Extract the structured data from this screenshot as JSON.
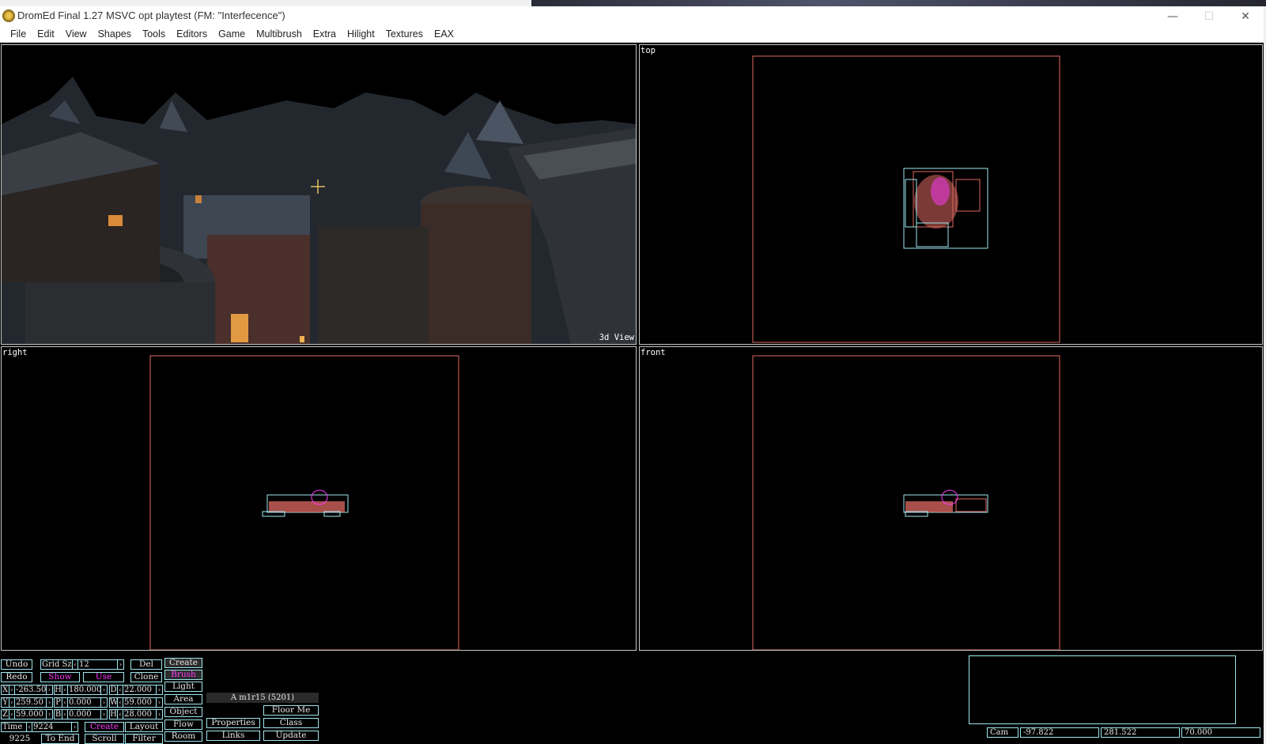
{
  "window": {
    "title": "DromEd Final 1.27 MSVC opt playtest (FM: \"Interfecence\")",
    "icon": "dromed-app-icon",
    "controls": {
      "minimize": "—",
      "maximize": "☐",
      "close": "✕"
    }
  },
  "menu": [
    "File",
    "Edit",
    "View",
    "Shapes",
    "Tools",
    "Editors",
    "Game",
    "Multibrush",
    "Extra",
    "Hilight",
    "Textures",
    "EAX"
  ],
  "viewports": {
    "view3d": "3d View",
    "top": "top",
    "right": "right",
    "front": "front"
  },
  "colors": {
    "wire_red": "#e06a62",
    "wire_cyan": "#9fe7f0",
    "wire_magenta": "#ff3aff",
    "panel_border": "#9fe7f0"
  },
  "toolbar": {
    "undo": "Undo",
    "redo": "Redo",
    "grid_label": "Grid Sz",
    "grid_value": "12",
    "del": "Del",
    "clone": "Clone",
    "show": "Show",
    "use": "Use",
    "create": "Create",
    "brush": "Brush",
    "light": "Light",
    "area": "Area",
    "object": "Object",
    "flow": "Flow",
    "room": "Room",
    "layout": "Layout",
    "scroll": "Scroll",
    "filter": "Filter",
    "to_end": "To End",
    "create2": "Create",
    "properties": "Properties",
    "links": "Links",
    "class": "Class",
    "update": "Update",
    "floor_me": "Floor Me",
    "brush_info": "A m1r15 (5201)"
  },
  "coords": {
    "x": {
      "label": "X",
      "value": "-263.50"
    },
    "y": {
      "label": "Y",
      "value": "259.50"
    },
    "z": {
      "label": "Z",
      "value": "59.000"
    },
    "h": {
      "label": "H",
      "value": "180.000"
    },
    "p": {
      "label": "P",
      "value": "0.000"
    },
    "b": {
      "label": "B",
      "value": "0.000"
    },
    "d": {
      "label": "D",
      "value": "22.000"
    },
    "w": {
      "label": "W",
      "value": "59.000"
    },
    "hh": {
      "label": "H",
      "value": "28.000"
    }
  },
  "time": {
    "label": "Time",
    "value": "9224",
    "count": "9225"
  },
  "camera": {
    "label": "Cam",
    "x": "-97.822",
    "y": "281.522",
    "z": "70.000"
  }
}
